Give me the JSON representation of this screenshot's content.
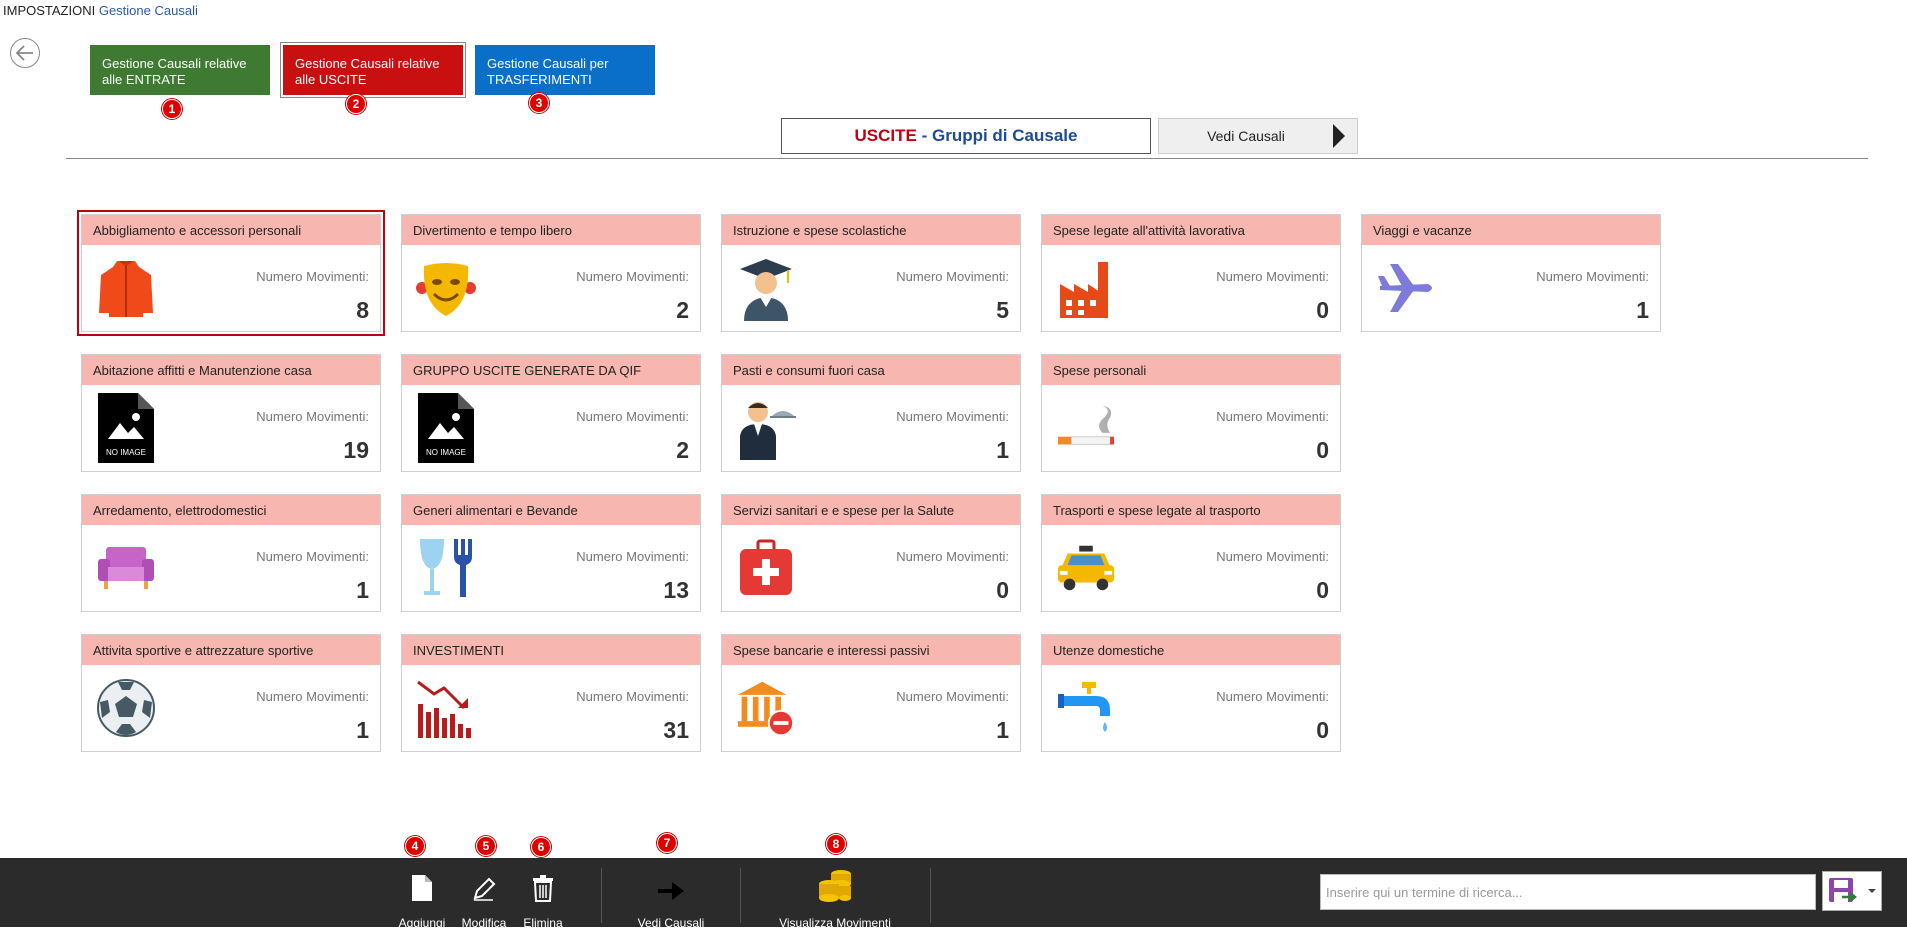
{
  "breadcrumb": {
    "root": "IMPOSTAZIONI",
    "current": "Gestione Causali"
  },
  "top_buttons": {
    "entrate": "Gestione Causali relative alle ENTRATE",
    "uscite": "Gestione Causali relative alle USCITE",
    "trasferimenti": "Gestione Causali per TRASFERIMENTI"
  },
  "markers": [
    "1",
    "2",
    "3",
    "4",
    "5",
    "6",
    "7",
    "8"
  ],
  "title": {
    "type": "USCITE",
    "sep": " - ",
    "rest": "Gruppi di Causale"
  },
  "vedi_causali_top": "Vedi Causali",
  "count_label": "Numero Movimenti:",
  "cards": [
    {
      "name": "Abbigliamento e accessori personali",
      "count": "8",
      "icon": "jacket-icon"
    },
    {
      "name": "Divertimento e tempo libero",
      "count": "2",
      "icon": "theater-mask-icon"
    },
    {
      "name": "Istruzione e spese scolastiche",
      "count": "5",
      "icon": "graduate-icon"
    },
    {
      "name": "Spese legate all'attività lavorativa",
      "count": "0",
      "icon": "factory-icon"
    },
    {
      "name": "Viaggi e vacanze",
      "count": "1",
      "icon": "airplane-icon"
    },
    {
      "name": "Abitazione affitti e Manutenzione casa",
      "count": "19",
      "icon": "no-image-icon"
    },
    {
      "name": "GRUPPO USCITE GENERATE DA QIF",
      "count": "2",
      "icon": "no-image-icon"
    },
    {
      "name": "Pasti e consumi fuori casa",
      "count": "1",
      "icon": "waiter-icon"
    },
    {
      "name": "Spese personali",
      "count": "0",
      "icon": "cigarette-icon"
    },
    {
      "name": "Arredamento, elettrodomestici",
      "count": "1",
      "icon": "sofa-icon"
    },
    {
      "name": "Generi alimentari e Bevande",
      "count": "13",
      "icon": "glass-fork-icon"
    },
    {
      "name": "Servizi sanitari e e spese per la Salute",
      "count": "0",
      "icon": "medical-kit-icon"
    },
    {
      "name": "Trasporti e spese legate al trasporto",
      "count": "0",
      "icon": "taxi-icon"
    },
    {
      "name": "Attivita sportive e attrezzature sportive",
      "count": "1",
      "icon": "soccer-ball-icon"
    },
    {
      "name": "INVESTIMENTI",
      "count": "31",
      "icon": "declining-chart-icon"
    },
    {
      "name": "Spese bancarie e interessi passivi",
      "count": "1",
      "icon": "bank-minus-icon"
    },
    {
      "name": "Utenze domestiche",
      "count": "0",
      "icon": "faucet-icon"
    }
  ],
  "no_image_text": "NO IMAGE",
  "toolbar": {
    "aggiungi": "Aggiungi",
    "modifica": "Modifica",
    "elimina": "Elimina",
    "vedi_causali": "Vedi Causali",
    "visualizza_movimenti": "Visualizza Movimenti"
  },
  "search": {
    "placeholder": "Inserire qui un termine di ricerca...",
    "value": ""
  }
}
